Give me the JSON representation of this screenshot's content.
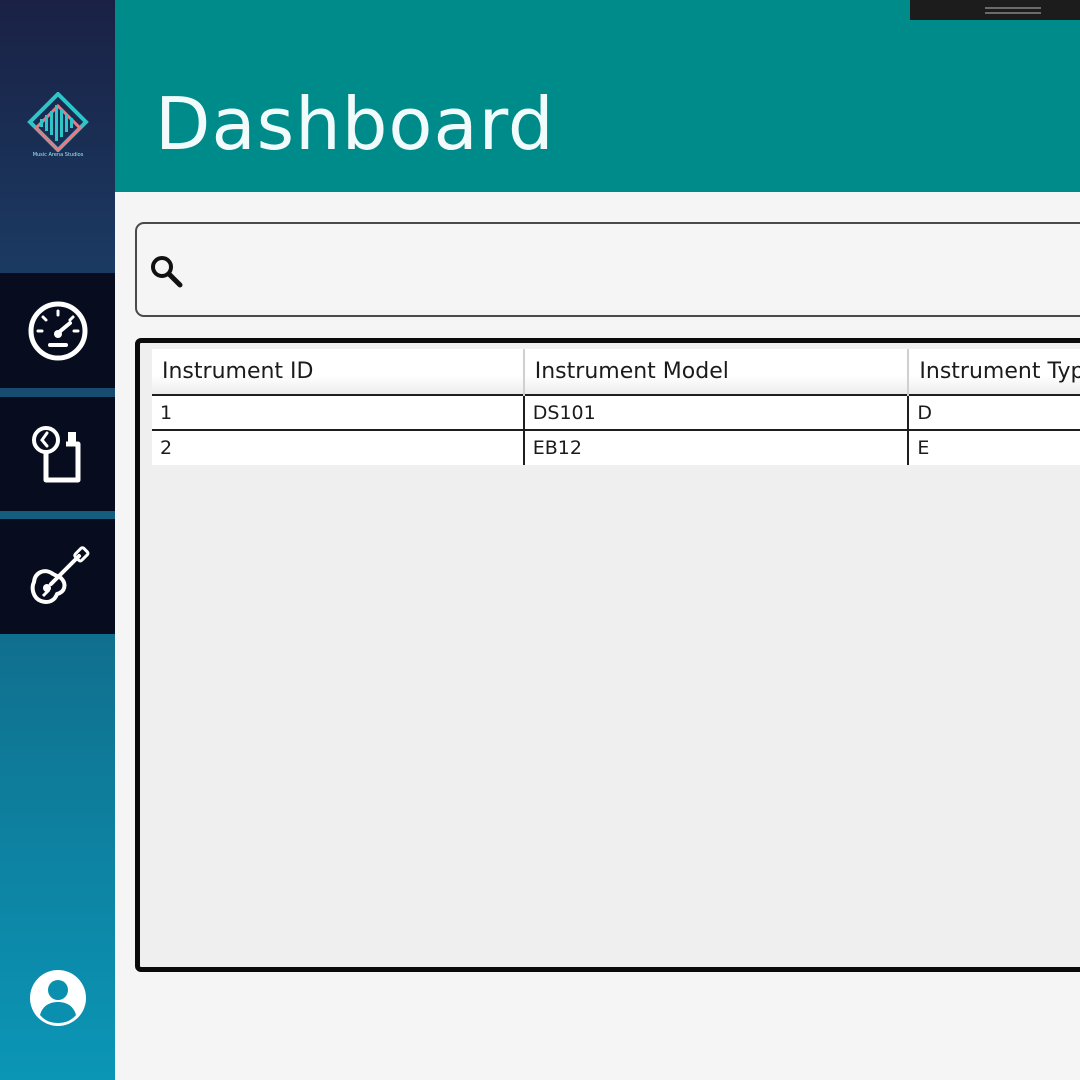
{
  "app": {
    "logo_caption": "Music Arena Studios"
  },
  "header": {
    "title": "Dashboard"
  },
  "sidebar": {
    "items": [
      {
        "id": "dashboard",
        "icon": "speedometer-icon"
      },
      {
        "id": "history",
        "icon": "clock-document-icon"
      },
      {
        "id": "instruments",
        "icon": "guitar-icon"
      }
    ],
    "user_icon": "user-avatar-icon"
  },
  "search": {
    "value": "",
    "placeholder": ""
  },
  "table": {
    "columns": [
      "Instrument ID",
      "Instrument Model",
      "Instrument Type"
    ],
    "rows": [
      [
        "1",
        "DS101",
        "D"
      ],
      [
        "2",
        "EB12",
        "E"
      ]
    ]
  },
  "colors": {
    "header": "#008b8b",
    "sidebar_top": "#1a2145",
    "sidebar_bottom": "#0b96b6",
    "nav_button": "#070d1e",
    "logo_teal": "#2ec4c8",
    "logo_pink": "#e87a84"
  }
}
